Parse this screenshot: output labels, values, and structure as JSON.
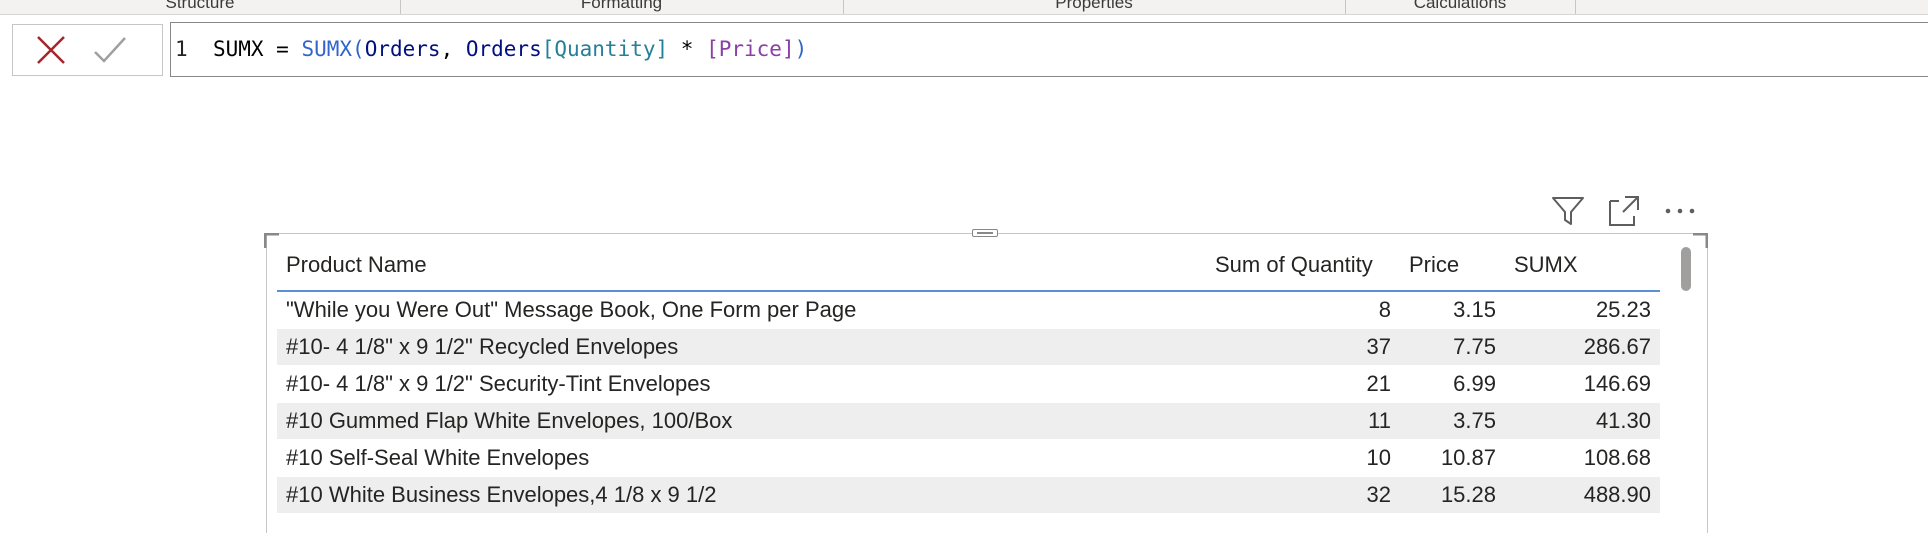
{
  "ribbon": {
    "groups": [
      "Structure",
      "Formatting",
      "Properties",
      "Calculations"
    ]
  },
  "formula_bar": {
    "cancel_icon": "close-x-icon",
    "commit_icon": "checkmark-icon",
    "line_number": "1",
    "tokens": {
      "measure_name": "SUMX",
      "equals": " = ",
      "function": "SUMX",
      "open_paren": "(",
      "table1": "Orders",
      "comma": ", ",
      "table2": "Orders",
      "column": "[Quantity]",
      "multiply": " * ",
      "measure_ref": "[Price]",
      "close_paren": ")"
    }
  },
  "visual_header": {
    "filter_icon": "filter-funnel-icon",
    "focus_icon": "focus-mode-icon",
    "more_icon": "more-options-icon"
  },
  "table": {
    "columns": [
      "Product Name",
      "Sum of Quantity",
      "Price",
      "SUMX"
    ],
    "rows": [
      [
        "\"While you Were Out\" Message Book, One Form per Page",
        "8",
        "3.15",
        "25.23"
      ],
      [
        "#10- 4 1/8\" x 9 1/2\" Recycled Envelopes",
        "37",
        "7.75",
        "286.67"
      ],
      [
        "#10- 4 1/8\" x 9 1/2\" Security-Tint Envelopes",
        "21",
        "6.99",
        "146.69"
      ],
      [
        "#10 Gummed Flap White Envelopes, 100/Box",
        "11",
        "3.75",
        "41.30"
      ],
      [
        "#10 Self-Seal White Envelopes",
        "10",
        "10.87",
        "108.68"
      ],
      [
        "#10 White Business Envelopes,4 1/8 x 9 1/2",
        "32",
        "15.28",
        "488.90"
      ]
    ]
  },
  "colors": {
    "header_underline": "#5b8fd6",
    "alt_row": "#eeeeee",
    "cancel_icon": "#a4262c",
    "dax_function": "#3165cc",
    "dax_column": "#267f99",
    "dax_measure": "#8a3fa6"
  }
}
